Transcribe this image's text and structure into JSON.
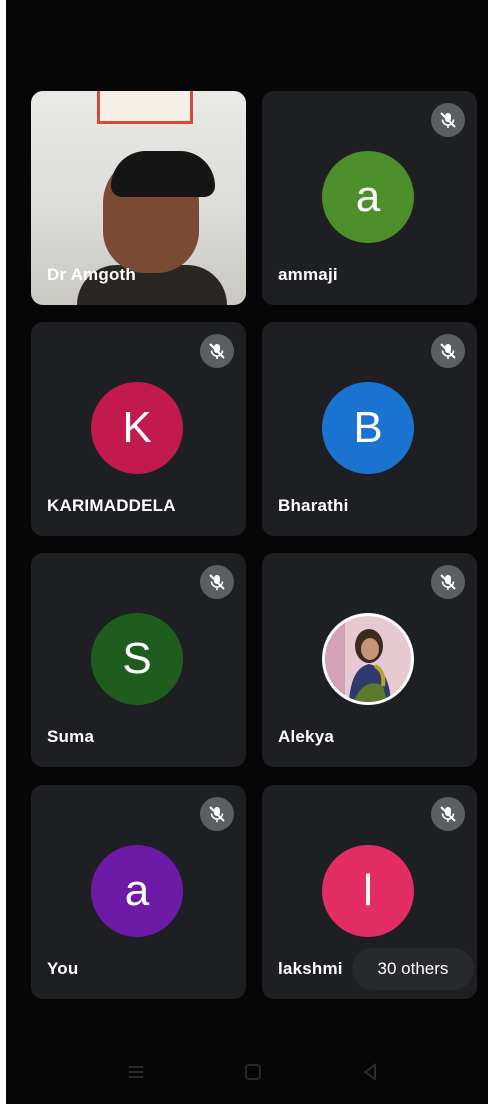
{
  "participants": [
    {
      "name": "Dr Amgoth",
      "type": "video",
      "muted": false
    },
    {
      "name": "ammaji",
      "initial": "a",
      "avatar_color": "#4d8f2a",
      "muted": true
    },
    {
      "name": "KARIMADDELA",
      "initial": "K",
      "avatar_color": "#c2194f",
      "muted": true
    },
    {
      "name": "Bharathi",
      "initial": "B",
      "avatar_color": "#1a73d1",
      "muted": true
    },
    {
      "name": "Suma",
      "initial": "S",
      "avatar_color": "#1f5d1f",
      "muted": true
    },
    {
      "name": "Alekya",
      "type": "photo",
      "muted": true
    },
    {
      "name": "You",
      "initial": "a",
      "avatar_color": "#6d1aa6",
      "muted": true
    },
    {
      "name": "lakshmi",
      "initial": "l",
      "avatar_color": "#e22d65",
      "muted": true
    }
  ],
  "others_label": "30 others",
  "icons": {
    "muted": "mic-off-icon",
    "nav_menu": "menu-icon",
    "nav_home": "home-icon",
    "nav_back": "back-icon"
  }
}
